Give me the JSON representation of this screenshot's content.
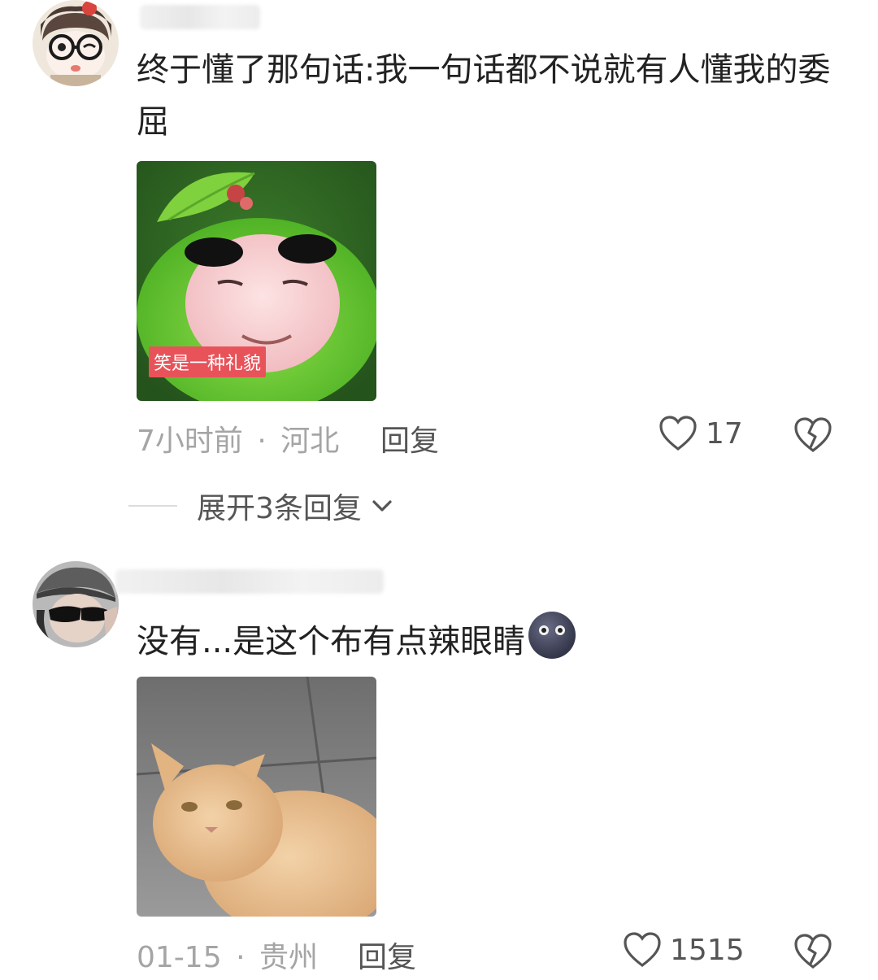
{
  "comments": [
    {
      "text": "终于懂了那句话:我一句话都不说就有人懂我的委屈",
      "meme_caption": "笑是一种礼貌",
      "time": "7小时前",
      "separator": "·",
      "location": "河北",
      "reply_label": "回复",
      "likes": "17",
      "expand_label": "展开3条回复"
    },
    {
      "text": "没有...是这个布有点辣眼睛",
      "time": "01-15",
      "separator": "·",
      "location": "贵州",
      "reply_label": "回复",
      "likes": "1515"
    }
  ],
  "colors": {
    "meta": "#a5a5a5",
    "action": "#555555",
    "text": "#222222",
    "caption_bg": "#e8535a"
  },
  "icons": [
    "heart-outline-icon",
    "broken-heart-icon",
    "chevron-down-icon",
    "new-moon-face-emoji"
  ]
}
